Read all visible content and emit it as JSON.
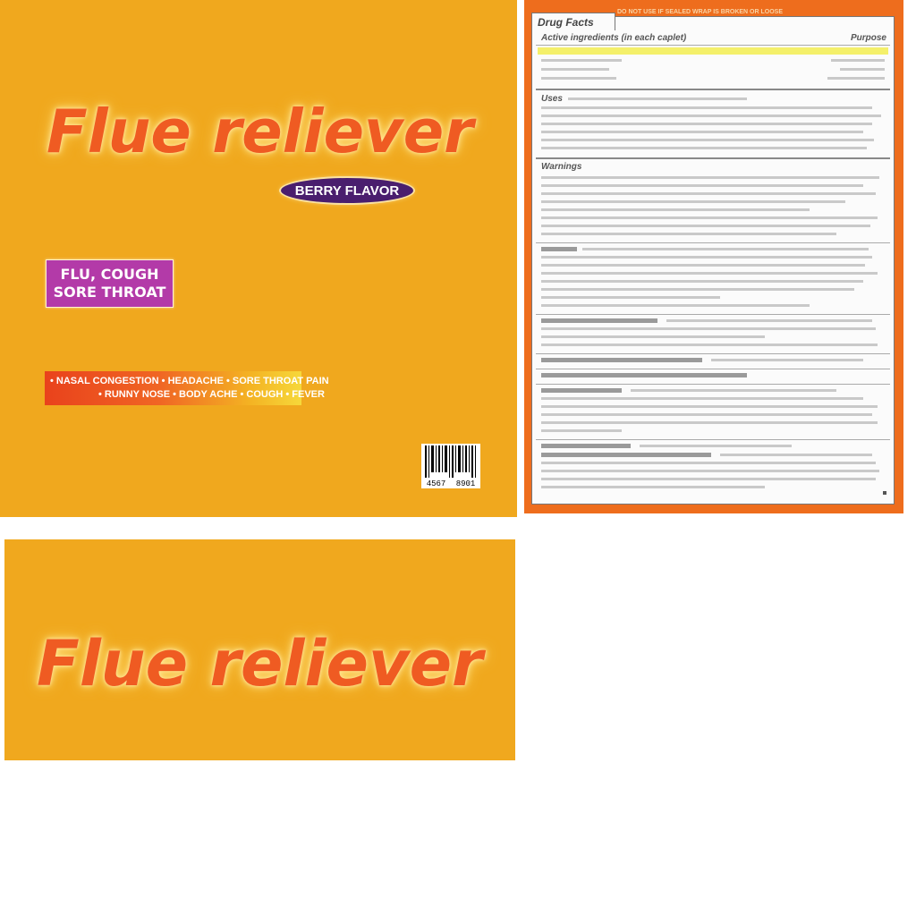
{
  "front": {
    "brand": "Flue reliever",
    "flavor": "BERRY FLAVOR",
    "box_line1": "FLU, COUGH",
    "box_line2": "SORE THROAT",
    "symptoms_line1": "• NASAL CONGESTION • HEADACHE • SORE THROAT PAIN",
    "symptoms_line2": "• RUNNY NOSE • BODY ACHE • COUGH • FEVER",
    "barcode_left": "4567",
    "barcode_right": "8901"
  },
  "facts": {
    "tab": "Drug Facts",
    "top_warning": "DO NOT USE IF SEALED WRAP IS BROKEN OR LOOSE",
    "active_header": "Active ingredients (in each caplet)",
    "purpose_header": "Purpose",
    "uses_header": "Uses",
    "warnings_header": "Warnings"
  },
  "back": {
    "brand": "Flue reliever"
  },
  "colors": {
    "package_orange": "#f0a81e",
    "brand_text": "#ef5b22",
    "flavor_badge": "#4a1e6e",
    "box_purple": "#b33aa8",
    "facts_border": "#ee6d1d"
  }
}
